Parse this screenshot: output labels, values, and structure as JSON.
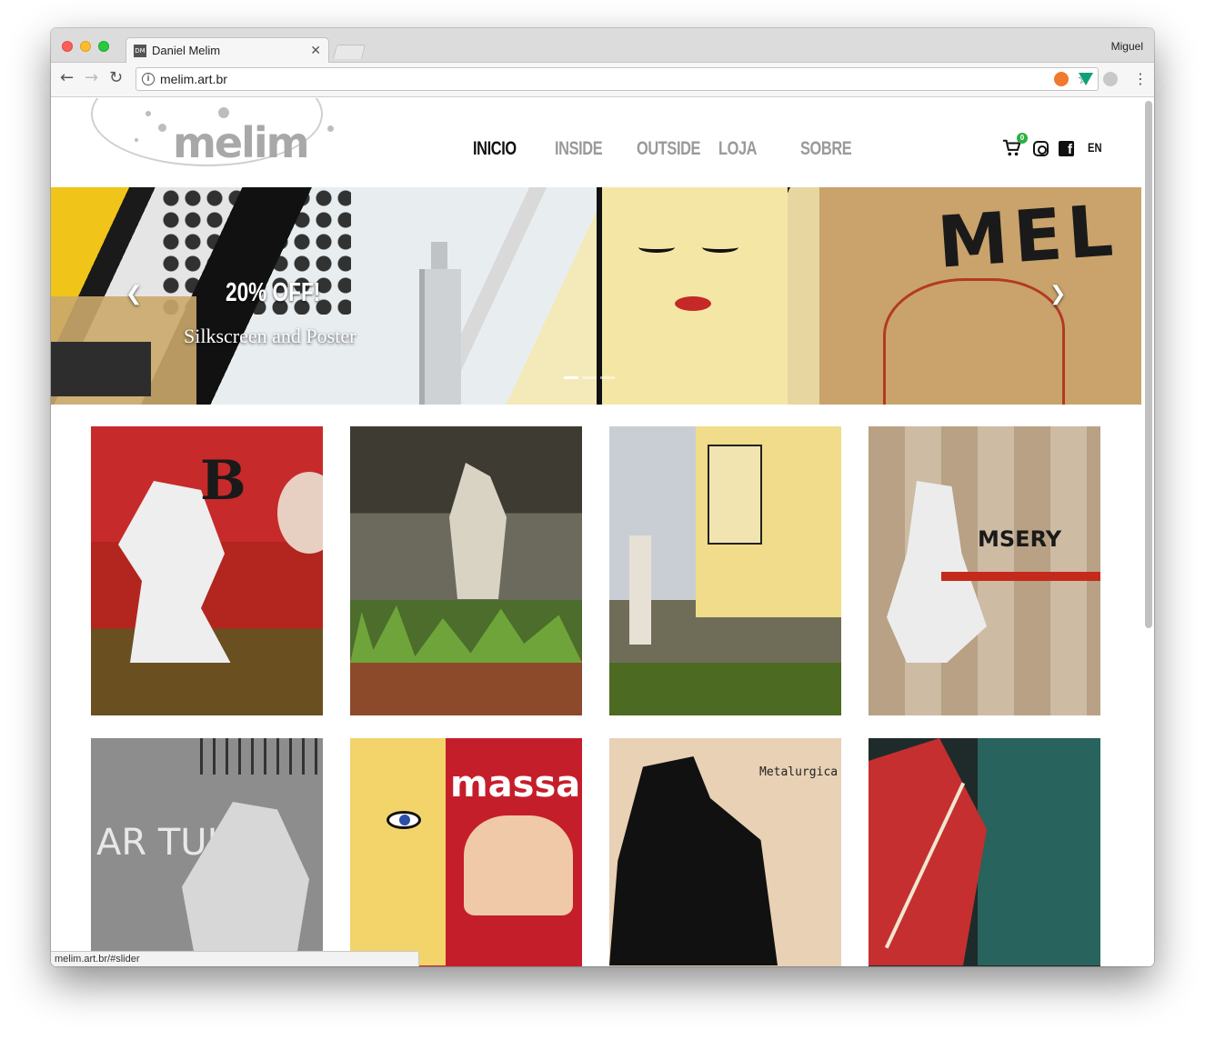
{
  "browser": {
    "tab_title": "Daniel Melim",
    "tab_favicon": "DM",
    "profile_name": "Miguel",
    "url": "melim.art.br",
    "status_url": "melim.art.br/#slider"
  },
  "site": {
    "logo_text": "melim",
    "nav": [
      {
        "label": "INICIO",
        "active": true
      },
      {
        "label": "INSIDE",
        "active": false
      },
      {
        "label": "OUTSIDE",
        "active": false
      },
      {
        "label": "LOJA",
        "active": false
      },
      {
        "label": "SOBRE",
        "active": false
      }
    ],
    "cart_count": "0",
    "language": "EN"
  },
  "slider": {
    "title": "20% OFF!",
    "subtitle": "Silkscreen and Poster",
    "prev_arrow": "❮",
    "next_arrow": "❯",
    "indicator_count": 3,
    "active_indicator": 0
  },
  "gallery": {
    "items": [
      {
        "name": "gallery-item-1",
        "visible_text": "B"
      },
      {
        "name": "gallery-item-2",
        "visible_text": ""
      },
      {
        "name": "gallery-item-3",
        "visible_text": ""
      },
      {
        "name": "gallery-item-4",
        "visible_text": "MSERY"
      },
      {
        "name": "gallery-item-5",
        "visible_text": "AR TULH"
      },
      {
        "name": "gallery-item-6",
        "visible_text": "massas"
      },
      {
        "name": "gallery-item-7",
        "visible_text": "Metalurgica"
      },
      {
        "name": "gallery-item-8",
        "visible_text": ""
      }
    ]
  },
  "slide_art": {
    "stencil_text": "MEL"
  },
  "colors": {
    "nav_active": "#111111",
    "nav_inactive": "#9a9a9a",
    "cart_badge": "#2bb041"
  }
}
